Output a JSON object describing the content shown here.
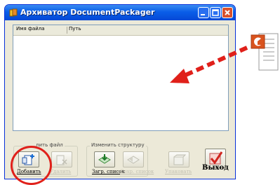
{
  "window": {
    "title": "Архиватор DocumentPackager"
  },
  "list": {
    "columns": [
      "Имя файла",
      "Путь"
    ]
  },
  "groups": {
    "file": "…лить файл",
    "structure": "Изменить структуру"
  },
  "buttons": {
    "add": "Добавить",
    "remove": "Удалить",
    "load_list": "Загр. список",
    "save_list": "Сохр. список",
    "package": "Упаковать",
    "exit": "Выход"
  },
  "colors": {
    "accent": "#e0201a",
    "titlebar": "#0a5ee8"
  }
}
